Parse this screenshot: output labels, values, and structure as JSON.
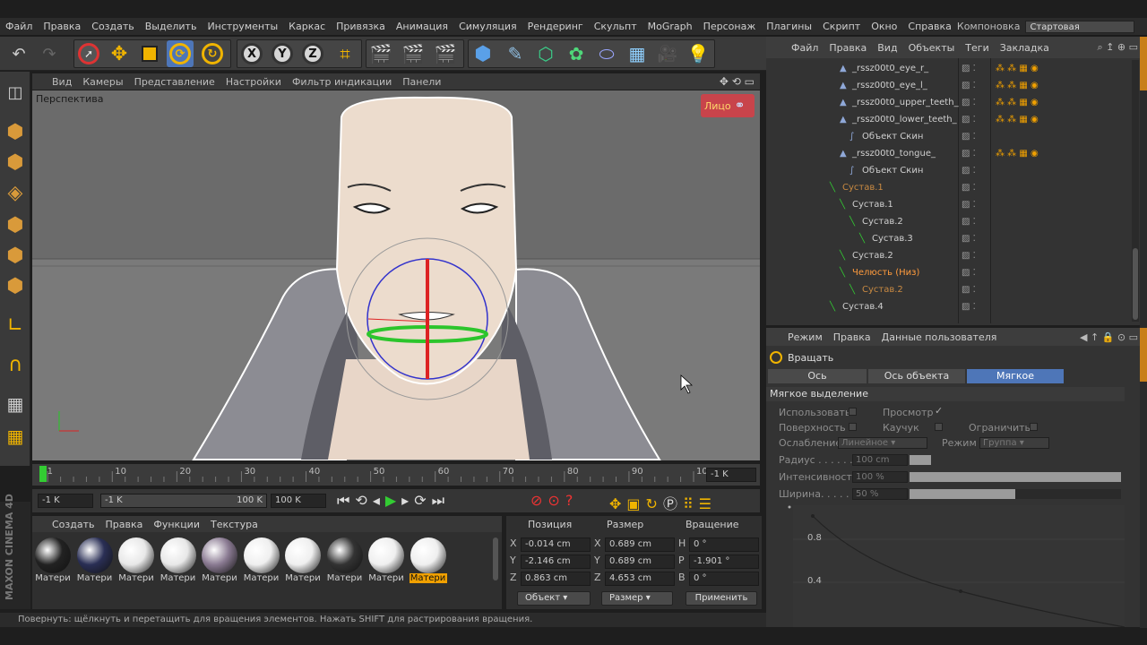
{
  "menubar": {
    "items": [
      "Файл",
      "Правка",
      "Создать",
      "Выделить",
      "Инструменты",
      "Каркас",
      "Привязка",
      "Анимация",
      "Симуляция",
      "Рендеринг",
      "Скульпт",
      "MoGraph",
      "Персонаж",
      "Плагины",
      "Скрипт",
      "Окно",
      "Справка"
    ],
    "layout_label": "Компоновка",
    "layout_value": "Стартовая"
  },
  "viewport": {
    "menu": [
      "Вид",
      "Камеры",
      "Представление",
      "Настройки",
      "Фильтр индикации",
      "Панели"
    ],
    "label": "Перспектива",
    "face_chip": "Лицо"
  },
  "timeline": {
    "ticks": [
      "-1",
      "10",
      "20",
      "30",
      "40",
      "50",
      "60",
      "70",
      "80",
      "90",
      "100"
    ],
    "end_value": "-1 K",
    "start_field": "-1 K",
    "range_start": "-1 K",
    "range_end": "100 K",
    "end_field": "100 K"
  },
  "materials": {
    "menu": [
      "Создать",
      "Правка",
      "Функции",
      "Текстура"
    ],
    "items": [
      {
        "label": "Матери",
        "color": "#222"
      },
      {
        "label": "Матери",
        "color": "#2a2f55"
      },
      {
        "label": "Матери",
        "color": "#e8e8e8"
      },
      {
        "label": "Матери",
        "color": "#e8e8e8"
      },
      {
        "label": "Матери",
        "color": "#8a7a92"
      },
      {
        "label": "Матери",
        "color": "#efefef"
      },
      {
        "label": "Матери",
        "color": "#efefef"
      },
      {
        "label": "Матери",
        "color": "#333"
      },
      {
        "label": "Матери",
        "color": "#efefef"
      },
      {
        "label": "Матери",
        "color": "#efefef"
      }
    ],
    "highlight_index": 9
  },
  "coords": {
    "headers": [
      "Позиция",
      "Размер",
      "Вращение"
    ],
    "rows": [
      {
        "p_label": "X",
        "p": "-0.014 cm",
        "s_label": "X",
        "s": "0.689 cm",
        "r_label": "H",
        "r": "0 °"
      },
      {
        "p_label": "Y",
        "p": "-2.146 cm",
        "s_label": "Y",
        "s": "0.689 cm",
        "r_label": "P",
        "r": "-1.901 °"
      },
      {
        "p_label": "Z",
        "p": "0.863 cm",
        "s_label": "Z",
        "s": "4.653 cm",
        "r_label": "B",
        "r": "0 °"
      }
    ],
    "mode1": "Объект",
    "mode2": "Размер",
    "apply": "Применить"
  },
  "statusbar": "Повернуть: щёлкнуть и перетащить для вращения элементов. Нажать SHIFT для растрирования вращения.",
  "objects": {
    "menu": [
      "Файл",
      "Правка",
      "Вид",
      "Объекты",
      "Теги",
      "Закладка"
    ],
    "rows": [
      {
        "name": "_rssz00t0_eye_r_",
        "indent": 0,
        "type": "mesh",
        "style": ""
      },
      {
        "name": "_rssz00t0_eye_l_",
        "indent": 0,
        "type": "mesh",
        "style": ""
      },
      {
        "name": "_rssz00t0_upper_teeth_",
        "indent": 0,
        "type": "mesh",
        "style": ""
      },
      {
        "name": "_rssz00t0_lower_teeth_",
        "indent": 0,
        "type": "mesh",
        "style": ""
      },
      {
        "name": "Объект Скин",
        "indent": 1,
        "type": "skin",
        "style": ""
      },
      {
        "name": "_rssz00t0_tongue_",
        "indent": 0,
        "type": "mesh",
        "style": ""
      },
      {
        "name": "Объект Скин",
        "indent": 1,
        "type": "skin",
        "style": ""
      },
      {
        "name": "Сустав.1",
        "indent": -1,
        "type": "joint",
        "style": "dim"
      },
      {
        "name": "Сустав.1",
        "indent": 0,
        "type": "joint",
        "style": ""
      },
      {
        "name": "Сустав.2",
        "indent": 1,
        "type": "joint",
        "style": ""
      },
      {
        "name": "Сустав.3",
        "indent": 2,
        "type": "joint",
        "style": ""
      },
      {
        "name": "Сустав.2",
        "indent": 0,
        "type": "joint",
        "style": ""
      },
      {
        "name": "Челюсть (Низ)",
        "indent": 0,
        "type": "joint",
        "style": "hl"
      },
      {
        "name": "Сустав.2",
        "indent": 1,
        "type": "joint",
        "style": "dim"
      },
      {
        "name": "Сустав.4",
        "indent": -1,
        "type": "joint",
        "style": ""
      }
    ]
  },
  "attributes": {
    "menu": [
      "Режим",
      "Правка",
      "Данные пользователя"
    ],
    "tool": "Вращать",
    "tabs": [
      "Ось моделирования",
      "Ось объекта",
      "Мягкое выделение"
    ],
    "section": "Мягкое выделение",
    "use": "Использовать",
    "preview": "Просмотр",
    "surface": "Поверхность",
    "rubber": "Каучук",
    "limit": "Ограничить",
    "falloff_label": "Ослабление",
    "falloff_value": "Линейное",
    "mode_label": "Режим",
    "mode_value": "Группа",
    "radius_label": "Радиус . . . . . . .",
    "radius_value": "100 cm",
    "strength_label": "Интенсивность",
    "strength_value": "100 %",
    "strength_level": 1.0,
    "width_label": "Ширина. . . . . . .",
    "width_value": "50 %",
    "width_level": 0.5,
    "graph_ticks": [
      "0.8",
      "0.4"
    ]
  }
}
